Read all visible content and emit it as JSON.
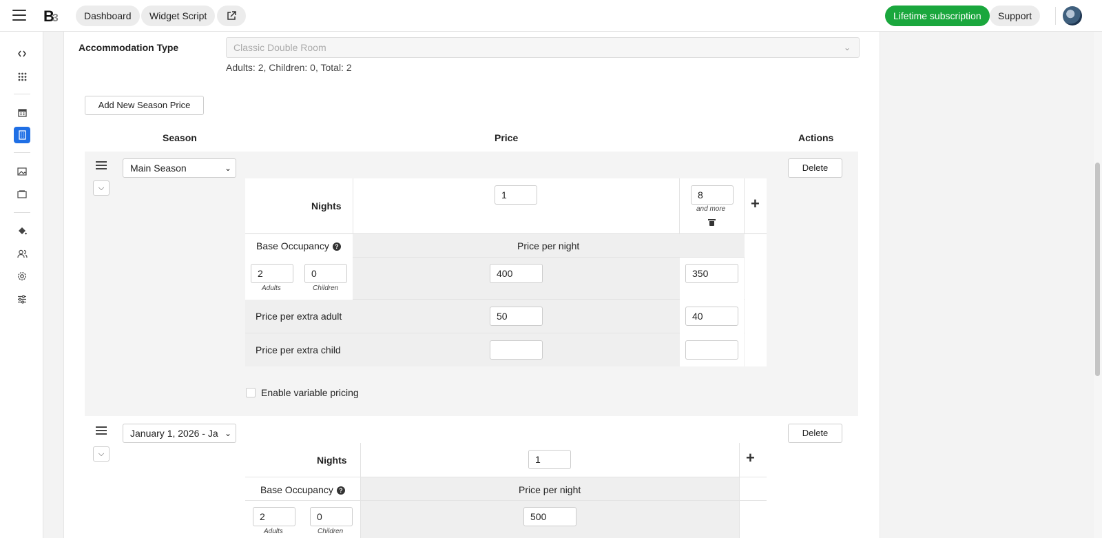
{
  "topbar": {
    "dashboard_label": "Dashboard",
    "widget_script_label": "Widget Script",
    "lifetime_label": "Lifetime subscription",
    "support_label": "Support",
    "accent_green": "#1aa73d"
  },
  "sidebar": {
    "icons": [
      "code-icon",
      "grid-icon",
      "calendar-icon",
      "building-icon",
      "image-icon",
      "window-icon",
      "paint-bucket-icon",
      "users-icon",
      "gear-icon",
      "sliders-icon"
    ],
    "active": "building-icon",
    "accent_blue": "#1f6fe5"
  },
  "form": {
    "accommodation_label": "Accommodation Type",
    "accommodation_value": "Classic Double Room",
    "occupancy_info": "Adults: 2, Children: 0, Total: 2",
    "add_season_label": "Add New Season Price"
  },
  "table_headers": {
    "season": "Season",
    "price": "Price",
    "actions": "Actions"
  },
  "seasons": [
    {
      "name": "Main Season",
      "delete_label": "Delete",
      "nights_label": "Nights",
      "nights": [
        "1",
        "8"
      ],
      "and_more": "and more",
      "base_occupancy_label": "Base Occupancy",
      "price_per_night_label": "Price per night",
      "adults": "2",
      "children": "0",
      "adults_caption": "Adults",
      "children_caption": "Children",
      "base_prices": [
        "400",
        "350"
      ],
      "extra_adult_label": "Price per extra adult",
      "extra_adult_prices": [
        "50",
        "40"
      ],
      "extra_child_label": "Price per extra child",
      "extra_child_prices": [
        "",
        ""
      ],
      "variable_pricing_label": "Enable variable pricing"
    },
    {
      "name": "January 1, 2026 - Ja",
      "delete_label": "Delete",
      "nights_label": "Nights",
      "nights": [
        "1"
      ],
      "base_occupancy_label": "Base Occupancy",
      "price_per_night_label": "Price per night",
      "adults": "2",
      "children": "0",
      "adults_caption": "Adults",
      "children_caption": "Children",
      "base_prices": [
        "500"
      ]
    }
  ]
}
